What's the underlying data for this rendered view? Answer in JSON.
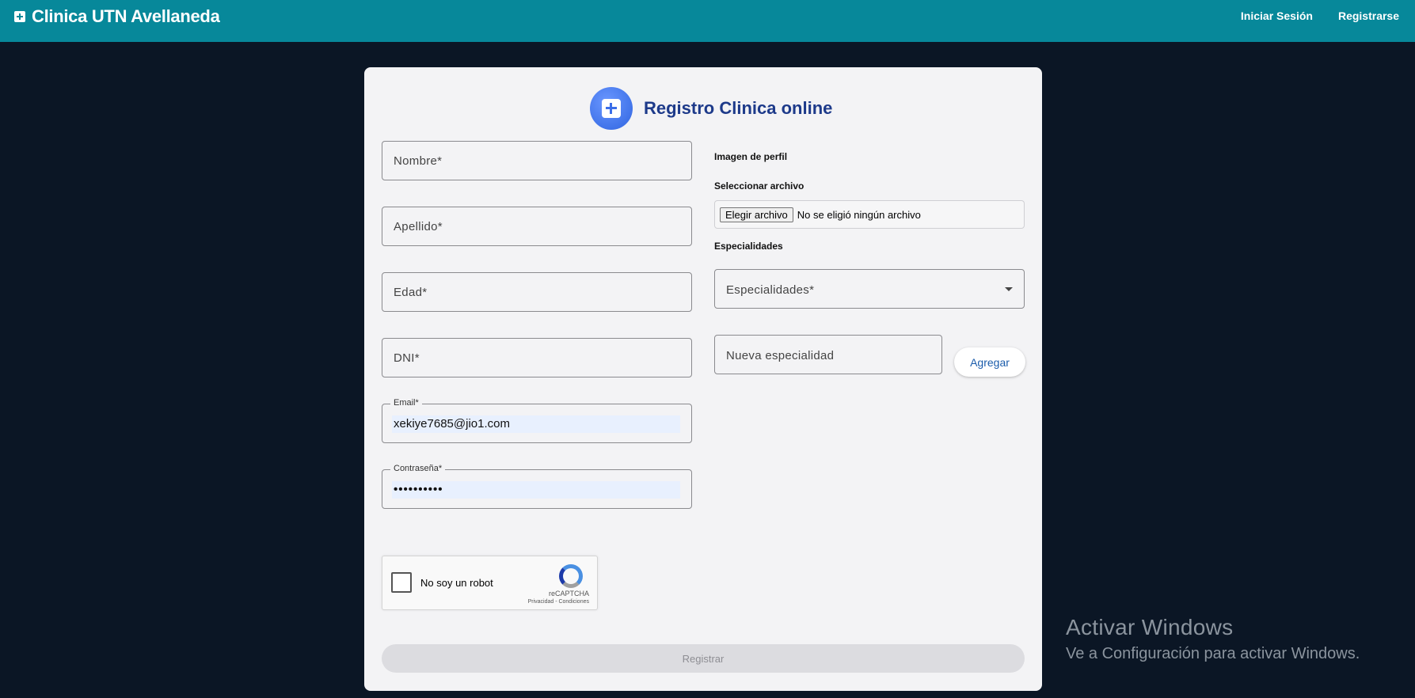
{
  "header": {
    "brand_icon": "medical-cross-icon",
    "brand_title": "Clinica UTN Avellaneda",
    "nav": {
      "login": "Iniciar Sesión",
      "register": "Registrarse"
    }
  },
  "form": {
    "title": "Registro Clinica online",
    "logo_icon": "medical-cross-icon",
    "nombre_placeholder": "Nombre*",
    "apellido_placeholder": "Apellido*",
    "edad_placeholder": "Edad*",
    "dni_placeholder": "DNI*",
    "email_label": "Email*",
    "email_value": "xekiye7685@jio1.com",
    "password_label": "Contraseña*",
    "password_value": "••••••••••",
    "image_label": "Imagen de perfil",
    "file_label": "Seleccionar archivo",
    "file_button": "Elegir archivo",
    "file_status": "No se eligió ningún archivo",
    "specialties_label": "Especialidades",
    "specialties_placeholder": "Especialidades*",
    "new_specialty_placeholder": "Nueva especialidad",
    "add_button": "Agregar",
    "recaptcha": {
      "label": "No soy un robot",
      "brand": "reCAPTCHA",
      "links": "Privacidad - Condiciones"
    },
    "submit_button": "Registrar"
  },
  "watermark": {
    "title": "Activar Windows",
    "subtitle": "Ve a Configuración para activar Windows."
  }
}
